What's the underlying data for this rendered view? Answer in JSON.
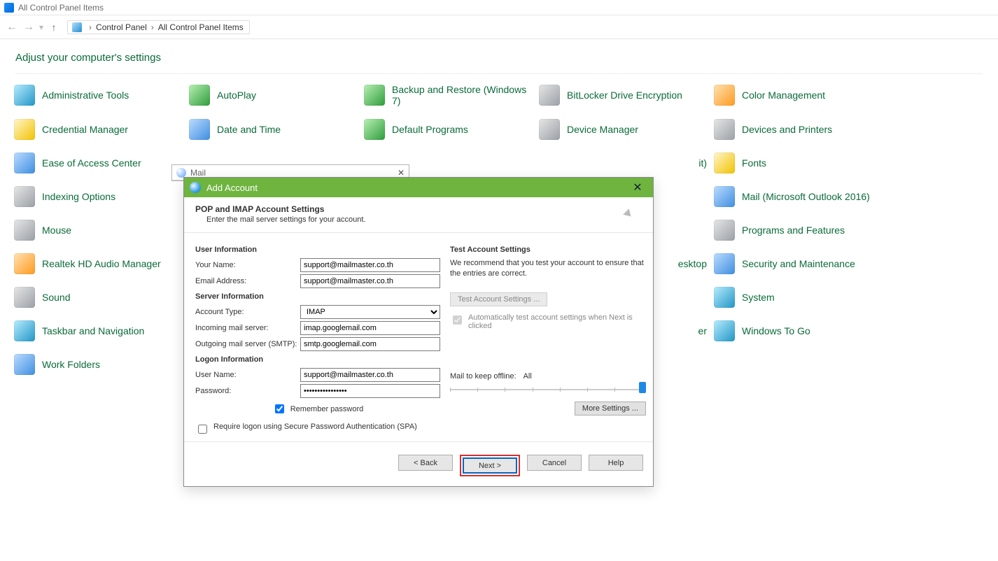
{
  "window": {
    "title": "All Control Panel Items"
  },
  "breadcrumb": {
    "root": "Control Panel",
    "current": "All Control Panel Items"
  },
  "heading": "Adjust your computer's settings",
  "items": [
    {
      "label": "Administrative Tools",
      "ic": "ic-teal"
    },
    {
      "label": "AutoPlay",
      "ic": "ic-green"
    },
    {
      "label": "Backup and Restore (Windows 7)",
      "ic": "ic-green"
    },
    {
      "label": "BitLocker Drive Encryption",
      "ic": "ic-gray"
    },
    {
      "label": "Color Management",
      "ic": "ic-orange"
    },
    {
      "label": "Credential Manager",
      "ic": "ic-yellow"
    },
    {
      "label": "Date and Time",
      "ic": "ic-blue"
    },
    {
      "label": "Default Programs",
      "ic": "ic-green"
    },
    {
      "label": "Device Manager",
      "ic": "ic-gray"
    },
    {
      "label": "Devices and Printers",
      "ic": "ic-gray"
    },
    {
      "label": "Ease of Access Center",
      "ic": "ic-blue"
    },
    {
      "label": "",
      "ic": ""
    },
    {
      "label": "",
      "ic": ""
    },
    {
      "label": "it)",
      "ic": ""
    },
    {
      "label": "Fonts",
      "ic": "ic-yellow"
    },
    {
      "label": "Indexing Options",
      "ic": "ic-gray"
    },
    {
      "label": "",
      "ic": ""
    },
    {
      "label": "",
      "ic": ""
    },
    {
      "label": "",
      "ic": ""
    },
    {
      "label": "Mail (Microsoft Outlook 2016)",
      "ic": "ic-blue"
    },
    {
      "label": "Mouse",
      "ic": "ic-gray"
    },
    {
      "label": "",
      "ic": ""
    },
    {
      "label": "",
      "ic": ""
    },
    {
      "label": "",
      "ic": ""
    },
    {
      "label": "Programs and Features",
      "ic": "ic-gray"
    },
    {
      "label": "Realtek HD Audio Manager",
      "ic": "ic-orange"
    },
    {
      "label": "",
      "ic": ""
    },
    {
      "label": "",
      "ic": ""
    },
    {
      "label": "esktop",
      "ic": ""
    },
    {
      "label": "Security and Maintenance",
      "ic": "ic-blue"
    },
    {
      "label": "Sound",
      "ic": "ic-gray"
    },
    {
      "label": "",
      "ic": ""
    },
    {
      "label": "",
      "ic": ""
    },
    {
      "label": "",
      "ic": ""
    },
    {
      "label": "System",
      "ic": "ic-teal"
    },
    {
      "label": "Taskbar and Navigation",
      "ic": "ic-teal"
    },
    {
      "label": "",
      "ic": ""
    },
    {
      "label": "",
      "ic": ""
    },
    {
      "label": "er",
      "ic": ""
    },
    {
      "label": "Windows To Go",
      "ic": "ic-teal"
    },
    {
      "label": "Work Folders",
      "ic": "ic-blue"
    }
  ],
  "mail_back_title": "Mail",
  "dialog": {
    "title": "Add Account",
    "header": {
      "h": "POP and IMAP Account Settings",
      "sub": "Enter the mail server settings for your account."
    },
    "sections": {
      "user_info": "User Information",
      "server_info": "Server Information",
      "logon_info": "Logon Information"
    },
    "labels": {
      "your_name": "Your Name:",
      "email": "Email Address:",
      "acct_type": "Account Type:",
      "incoming": "Incoming mail server:",
      "outgoing": "Outgoing mail server (SMTP):",
      "username": "User Name:",
      "password": "Password:",
      "remember": "Remember password",
      "spa": "Require logon using Secure Password Authentication (SPA)"
    },
    "values": {
      "your_name": "support@mailmaster.co.th",
      "email": "support@mailmaster.co.th",
      "acct_type": "IMAP",
      "incoming": "imap.googlemail.com",
      "outgoing": "smtp.googlemail.com",
      "username": "support@mailmaster.co.th",
      "password": "****************"
    },
    "right": {
      "title": "Test Account Settings",
      "desc": "We recommend that you test your account to ensure that the entries are correct.",
      "test_btn": "Test Account Settings ...",
      "auto_test": "Automatically test account settings when Next is clicked",
      "mail_offline_label": "Mail to keep offline:",
      "mail_offline_value": "All",
      "more_settings": "More Settings ..."
    },
    "footer": {
      "back": "< Back",
      "next": "Next >",
      "cancel": "Cancel",
      "help": "Help"
    }
  }
}
